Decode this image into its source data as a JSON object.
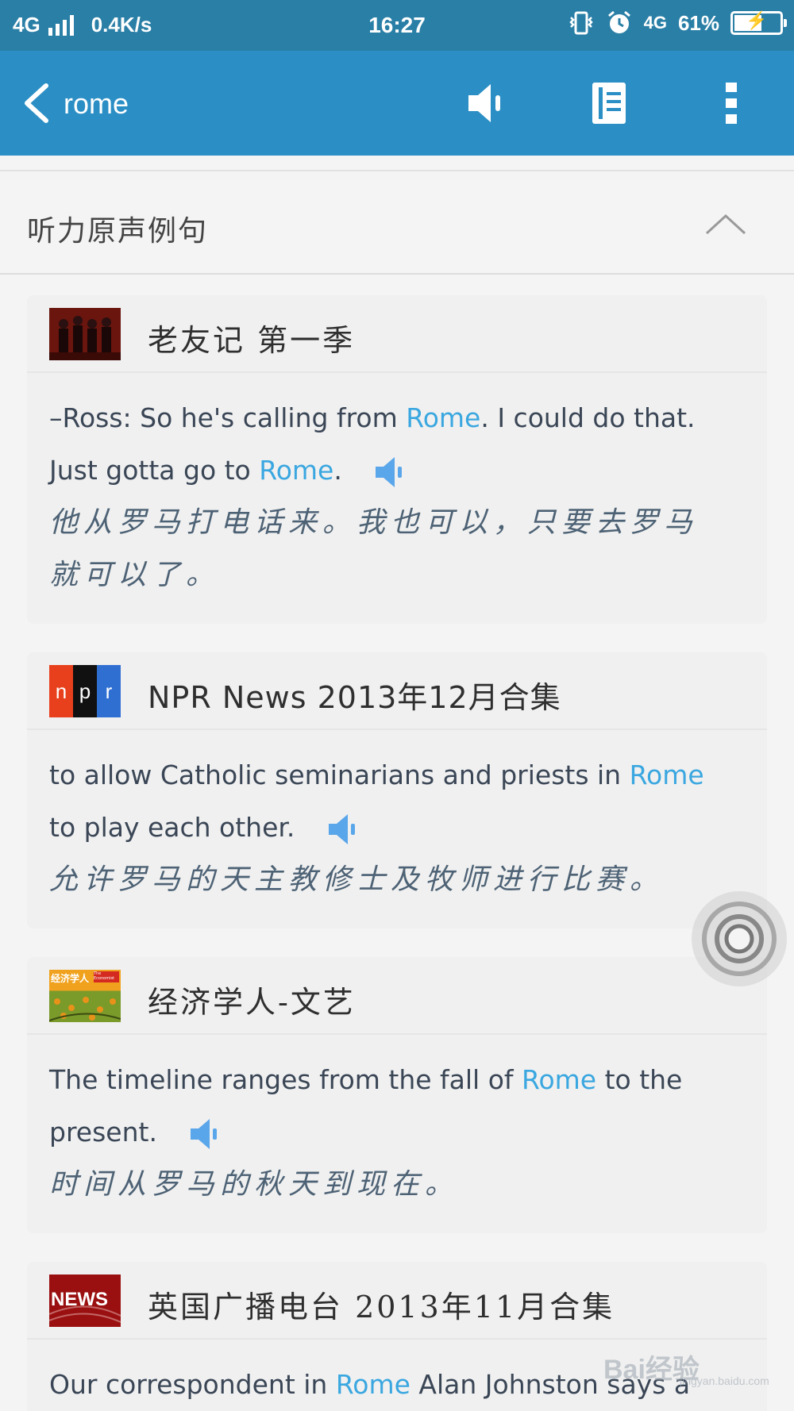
{
  "status_bar": {
    "network_left": "4G",
    "speed": "0.4K/s",
    "time": "16:27",
    "network_right": "4G",
    "battery_percent": "61%",
    "battery_level": 0.61
  },
  "app_bar": {
    "title": "rome",
    "icons": [
      "back-icon",
      "speaker-icon",
      "book-icon",
      "more-vertical-icon"
    ]
  },
  "section": {
    "title": "听力原声例句"
  },
  "cards": [
    {
      "source": "老友记 第一季",
      "en_parts": [
        "–Ross: So he's calling from ",
        "Rome",
        ". I could do that.",
        "Just gotta go to ",
        "Rome",
        "."
      ],
      "zh": [
        "他从罗马打电话来。我也可以，只要去罗马",
        "就可以了。"
      ]
    },
    {
      "source": "NPR News 2013年12月合集",
      "thumb_letters": [
        "n",
        "p",
        "r"
      ],
      "en_parts": [
        "to allow Catholic seminarians and priests in ",
        "Rome",
        "to play each other."
      ],
      "zh": [
        "允许罗马的天主教修士及牧师进行比赛。"
      ]
    },
    {
      "source": "经济学人-文艺",
      "thumb_text": "经济学人",
      "thumb_sub": "The Economist",
      "en_parts": [
        "The timeline ranges from the fall of ",
        "Rome",
        " to the",
        "present."
      ],
      "zh": [
        "时间从罗马的秋天到现在。"
      ]
    },
    {
      "source": "英国广播电台 2013年11月合集",
      "thumb_text": "NEWS",
      "en_parts": [
        "Our correspondent in ",
        "Rome",
        " Alan Johnston says a"
      ]
    }
  ],
  "watermark": {
    "text": "Bai经验",
    "sub": "jingyan.baidu.com"
  },
  "colors": {
    "status_bar": "#2a7fa6",
    "app_bar": "#2b8fc5",
    "highlight": "#3aa7e0",
    "speaker": "#5aa6ea"
  }
}
